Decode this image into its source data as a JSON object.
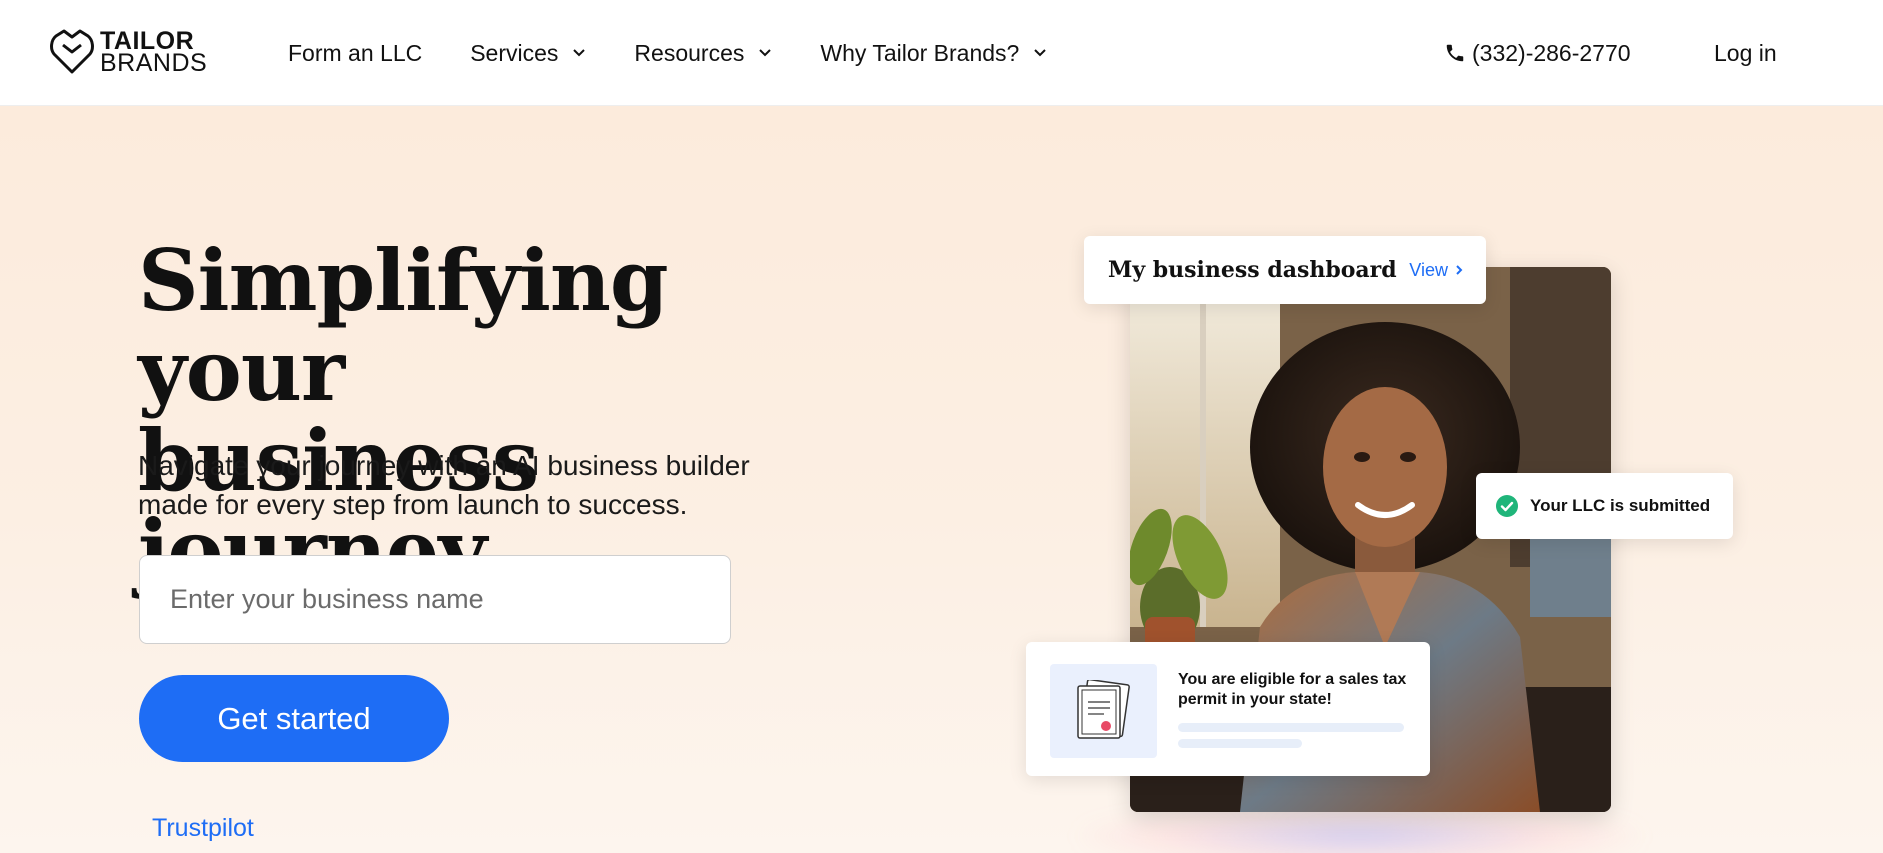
{
  "header": {
    "logo": {
      "line1": "TAILOR",
      "line2": "BRANDS",
      "icon": "heart-shield-icon"
    },
    "nav": [
      {
        "label": "Form an LLC",
        "has_dropdown": false
      },
      {
        "label": "Services",
        "has_dropdown": true
      },
      {
        "label": "Resources",
        "has_dropdown": true
      },
      {
        "label": "Why Tailor Brands?",
        "has_dropdown": true
      }
    ],
    "phone": {
      "icon": "phone-icon",
      "number": "(332)-286-2770"
    },
    "login_label": "Log in"
  },
  "hero": {
    "headline_line1": "Simplifying your",
    "headline_line2": "business journey",
    "subtext_line1": "Navigate your journey with an AI business builder",
    "subtext_line2": "made for every step from launch to success.",
    "business_input": {
      "placeholder": "Enter your business name",
      "value": ""
    },
    "cta_label": "Get started",
    "trustpilot_label": "Trustpilot"
  },
  "illustration": {
    "dashboard_card": {
      "title": "My business dashboard",
      "link_label": "View"
    },
    "llc_card": {
      "text": "Your LLC is submitted",
      "icon": "check-circle-icon"
    },
    "tax_card": {
      "text": "You are eligible for a sales tax permit in your state!",
      "icon": "certificate-icon"
    }
  },
  "colors": {
    "accent": "#1e6df5",
    "hero_bg": "#fcebdc",
    "check_green": "#1fb57a"
  }
}
